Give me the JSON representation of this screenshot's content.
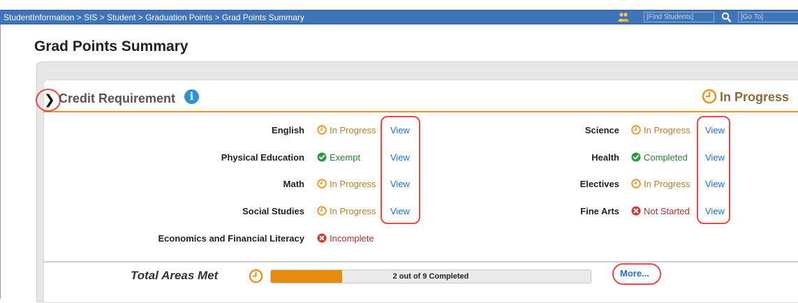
{
  "topbar": {
    "breadcrumb": "StudentInformation > SIS > Student > Graduation Points > Grad Points Summary",
    "find_placeholder": "[Find Students]",
    "goto_placeholder": "[Go To]"
  },
  "page": {
    "title": "Grad Points Summary"
  },
  "section": {
    "title": "Credit Requirement",
    "status": "In Progress"
  },
  "requirements_left": [
    {
      "label": "English",
      "status": "In Progress",
      "kind": "progress",
      "view": "View"
    },
    {
      "label": "Physical Education",
      "status": "Exempt",
      "kind": "done",
      "view": "View"
    },
    {
      "label": "Math",
      "status": "In Progress",
      "kind": "progress",
      "view": "View"
    },
    {
      "label": "Social Studies",
      "status": "In Progress",
      "kind": "progress",
      "view": "View"
    },
    {
      "label": "Economics and Financial Literacy",
      "status": "Incomplete",
      "kind": "bad",
      "view": ""
    }
  ],
  "requirements_right": [
    {
      "label": "Science",
      "status": "In Progress",
      "kind": "progress",
      "view": "View"
    },
    {
      "label": "Health",
      "status": "Completed",
      "kind": "done",
      "view": "View"
    },
    {
      "label": "Electives",
      "status": "In Progress",
      "kind": "progress",
      "view": "View"
    },
    {
      "label": "Fine Arts",
      "status": "Not Started",
      "kind": "bad",
      "view": "View"
    }
  ],
  "total": {
    "label": "Total Areas Met",
    "progress_text": "2 out of 9 Completed",
    "completed": 2,
    "total": 9,
    "more_label": "More..."
  },
  "colors": {
    "topbar": "#3f74b8",
    "accent_orange": "#e58c0a",
    "link_blue": "#1f6fd0",
    "highlight_red": "#e44a4a"
  }
}
